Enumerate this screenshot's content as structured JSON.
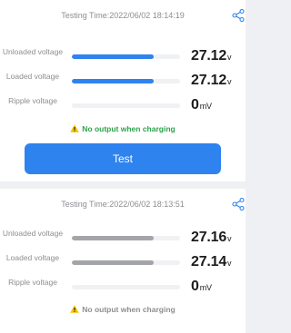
{
  "accent_color": "#2f83ee",
  "bar_inactive_color": "#a3a5a9",
  "warning_icon_color": "#f5c400",
  "tests": [
    {
      "time_text": "Testing Time:2022/06/02 18:14:19",
      "share_icon": "share-icon",
      "rows": [
        {
          "label": "Unloaded voltage",
          "value": "27.12",
          "unit": "v",
          "level": 0.76
        },
        {
          "label": "Loaded voltage",
          "value": "27.12",
          "unit": "v",
          "level": 0.76
        },
        {
          "label": "Ripple voltage",
          "value": "0",
          "unit": "mV",
          "level": 0
        }
      ],
      "notice": "No output when charging",
      "notice_color": "#2ea24a",
      "active": true
    },
    {
      "time_text": "Testing Time:2022/06/02 18:13:51",
      "share_icon": "share-icon",
      "rows": [
        {
          "label": "Unloaded voltage",
          "value": "27.16",
          "unit": "v",
          "level": 0.76
        },
        {
          "label": "Loaded voltage",
          "value": "27.14",
          "unit": "v",
          "level": 0.76
        },
        {
          "label": "Ripple voltage",
          "value": "0",
          "unit": "mV",
          "level": 0
        }
      ],
      "notice": "No output when charging",
      "notice_color": "#8e8e93",
      "active": false
    }
  ],
  "test_button_label": "Test"
}
